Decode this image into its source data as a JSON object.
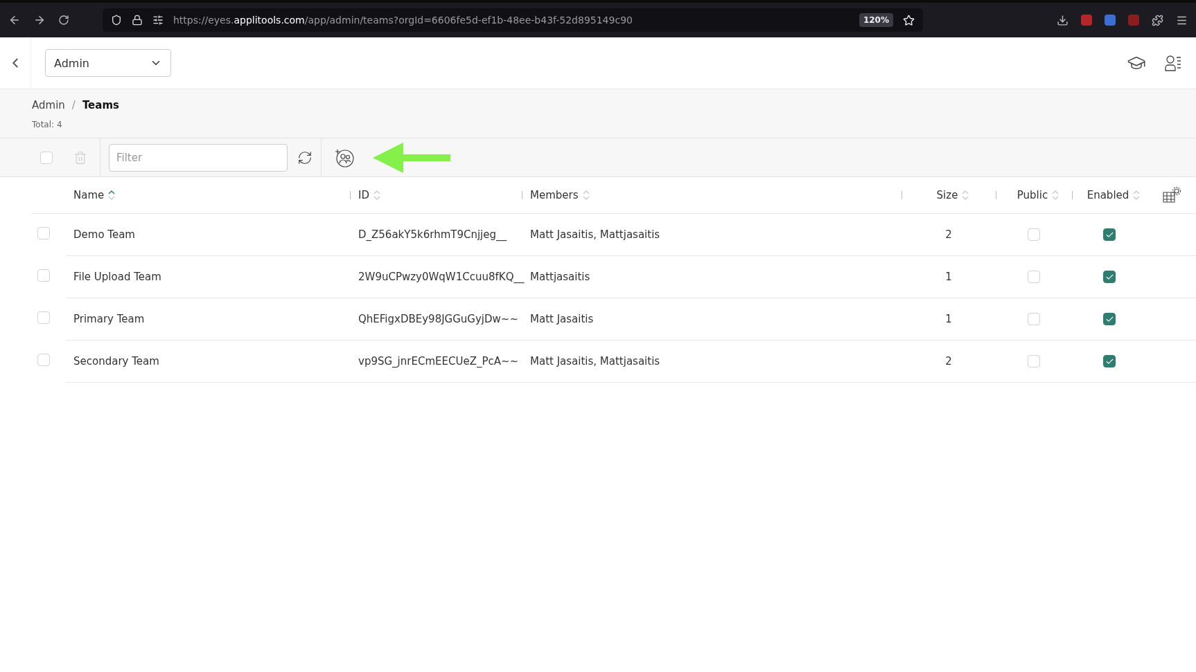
{
  "browser": {
    "url_prefix": "https://eyes.",
    "url_domain": "applitools.com",
    "url_rest": "/app/admin/teams?orgId=6606fe5d-ef1b-48ee-b43f-52d895149c90",
    "zoom": "120%"
  },
  "header": {
    "org_select": {
      "value": "Admin"
    }
  },
  "breadcrumb": {
    "separator": "/",
    "items": [
      {
        "label": "Admin",
        "current": false
      },
      {
        "label": "Teams",
        "current": true
      }
    ]
  },
  "total": "Total: 4",
  "toolbar": {
    "select_all": {
      "checked": false
    },
    "filter": {
      "placeholder": "Filter"
    }
  },
  "table": {
    "columns": [
      {
        "label": "Name",
        "sorted": true,
        "kind": "text"
      },
      {
        "label": "ID",
        "sorted": false,
        "kind": "text"
      },
      {
        "label": "Members",
        "sorted": false,
        "kind": "text"
      },
      {
        "label": "Size",
        "sorted": false,
        "kind": "number"
      },
      {
        "label": "Public",
        "sorted": false,
        "kind": "check"
      },
      {
        "label": "Enabled",
        "sorted": false,
        "kind": "check"
      }
    ],
    "rows": [
      {
        "selected": false,
        "name": "Demo Team",
        "id": "D_Z56akY5k6rhmT9Cnjjeg__",
        "members": "Matt Jasaitis, Mattjasaitis",
        "size": "2",
        "public": false,
        "enabled": true
      },
      {
        "selected": false,
        "name": "File Upload Team",
        "id": "2W9uCPwzy0WqW1Ccuu8fKQ__",
        "members": "Mattjasaitis",
        "size": "1",
        "public": false,
        "enabled": true
      },
      {
        "selected": false,
        "name": "Primary Team",
        "id": "QhEFigxDBEy98JGGuGyjDw~~",
        "members": "Matt Jasaitis",
        "size": "1",
        "public": false,
        "enabled": true
      },
      {
        "selected": false,
        "name": "Secondary Team",
        "id": "vp9SG_jnrECmEECUeZ_PcA~~",
        "members": "Matt Jasaitis, Mattjasaitis",
        "size": "2",
        "public": false,
        "enabled": true
      }
    ]
  }
}
